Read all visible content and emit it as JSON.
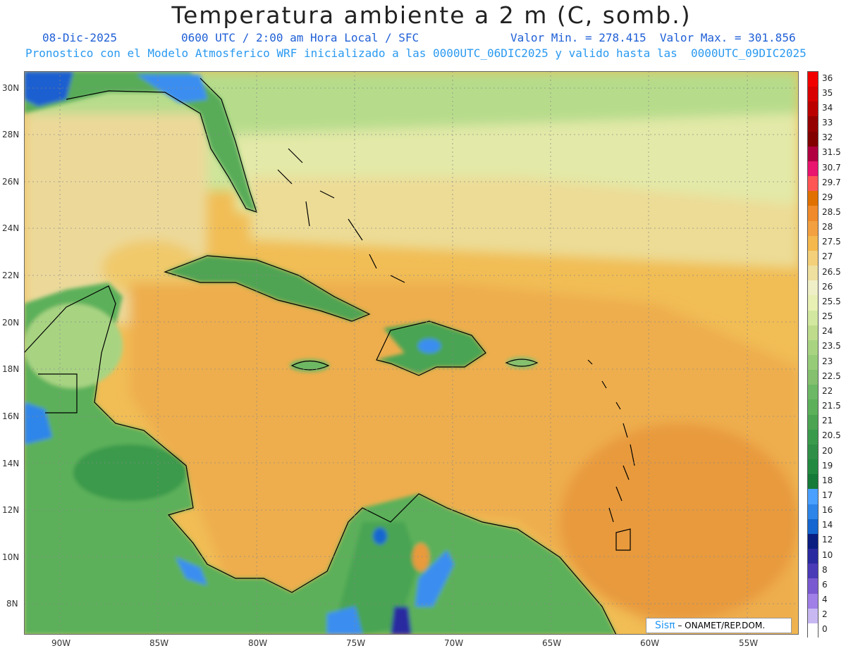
{
  "title": "Temperatura ambiente a 2 m (C, somb.)",
  "date": "08-Dic-2025",
  "valid_time": "0600 UTC / 2:00 am Hora Local / SFC",
  "min_max": "Valor Min. = 278.415  Valor Max. = 301.856",
  "model_info": "Pronostico con el Modelo Atmosferico WRF inicializado a las 0000UTC_06DIC2025 y valido hasta las  0000UTC_09DIC2025",
  "lat_labels": [
    "30N",
    "28N",
    "26N",
    "24N",
    "22N",
    "20N",
    "18N",
    "16N",
    "14N",
    "12N",
    "10N",
    "8N"
  ],
  "lon_labels": [
    "90W",
    "85W",
    "80W",
    "75W",
    "70W",
    "65W",
    "60W",
    "55W"
  ],
  "colorbar": {
    "labels": [
      "36",
      "35",
      "34",
      "33",
      "32",
      "31.5",
      "30.7",
      "29.7",
      "29",
      "28.5",
      "28",
      "27.5",
      "27",
      "26.5",
      "26",
      "25.5",
      "25",
      "24",
      "23.5",
      "23",
      "22.5",
      "22",
      "21.5",
      "21",
      "20.5",
      "20",
      "19",
      "18",
      "17",
      "16",
      "14",
      "12",
      "10",
      "8",
      "6",
      "4",
      "2",
      "0"
    ],
    "colors": [
      "#f20000",
      "#d80000",
      "#bb0000",
      "#950000",
      "#820000",
      "#b00040",
      "#e8146e",
      "#ff5555",
      "#e07000",
      "#f08a2a",
      "#f2a040",
      "#f5b84d",
      "#f4d07a",
      "#efe0a0",
      "#f0f0c8",
      "#e8f0b4",
      "#d2e8a0",
      "#bedc8c",
      "#a8d482",
      "#96cc78",
      "#84c06e",
      "#6cb864",
      "#5cb05a",
      "#4aa452",
      "#3a9a4c",
      "#2f8f46",
      "#228a40",
      "#157a38",
      "#4aa0ff",
      "#2d85ea",
      "#1566d0",
      "#0a1e82",
      "#2a2aa0",
      "#4a3ab8",
      "#7a5ad0",
      "#a080e6",
      "#c8b8f2",
      "#ffffff"
    ]
  },
  "credit": {
    "brand": "Sisπ",
    "text": "– ONAMET/REP.DOM."
  }
}
